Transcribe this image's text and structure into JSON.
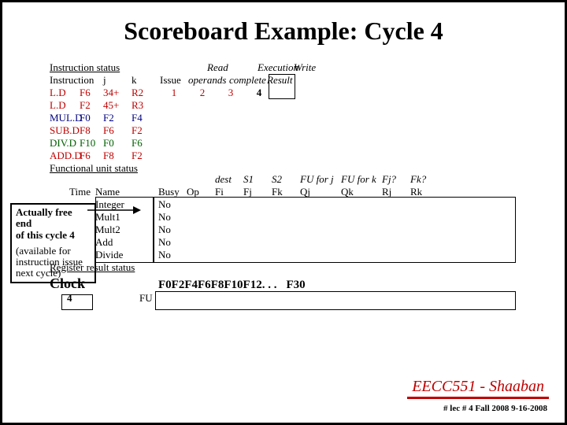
{
  "title": "Scoreboard Example:  Cycle 4",
  "is": {
    "hdr": "Instruction status",
    "cols": {
      "instr": "Instruction",
      "j": "j",
      "k": "k",
      "issue": "Issue",
      "read": "Read\noperands",
      "exec": "Execution\ncomplete",
      "write": "Write\nResult"
    },
    "rows": [
      {
        "c1": "L.D",
        "c2": "F6",
        "j": "34+",
        "k": "R2",
        "issue": "1",
        "read": "2",
        "exec": "3",
        "write": "4",
        "cls": "red"
      },
      {
        "c1": "L.D",
        "c2": "F2",
        "j": "45+",
        "k": "R3",
        "issue": "",
        "read": "",
        "exec": "",
        "write": "",
        "cls": "red"
      },
      {
        "c1": "MUL.D",
        "c2": "F0",
        "j": "F2",
        "k": "F4",
        "issue": "",
        "read": "",
        "exec": "",
        "write": "",
        "cls": "blue"
      },
      {
        "c1": "SUB.D",
        "c2": "F8",
        "j": "F6",
        "k": "F2",
        "issue": "",
        "read": "",
        "exec": "",
        "write": "",
        "cls": "red"
      },
      {
        "c1": "DIV.D",
        "c2": "F10",
        "j": "F0",
        "k": "F6",
        "issue": "",
        "read": "",
        "exec": "",
        "write": "",
        "cls": "green"
      },
      {
        "c1": "ADD.D",
        "c2": "F6",
        "j": "F8",
        "k": "F2",
        "issue": "",
        "read": "",
        "exec": "",
        "write": "",
        "cls": "red"
      }
    ]
  },
  "fu": {
    "hdr": "Functional unit status",
    "cols": {
      "time": "Time",
      "name": "Name",
      "busy": "Busy",
      "op": "Op",
      "fi": "Fi",
      "fj": "Fj",
      "fk": "Fk",
      "qj": "Qj",
      "qk": "Qk",
      "rj": "Rj",
      "rk": "Rk",
      "dest": "dest",
      "s1": "S1",
      "s2": "S2",
      "fuj": "FU for j",
      "fuk": "FU for k",
      "fjq": "Fj?",
      "fkq": "Fk?"
    },
    "rows": [
      {
        "name": "Integer",
        "busy": "No"
      },
      {
        "name": "Mult1",
        "busy": "No"
      },
      {
        "name": "Mult2",
        "busy": "No"
      },
      {
        "name": "Add",
        "busy": "No"
      },
      {
        "name": "Divide",
        "busy": "No"
      }
    ],
    "rrs": "Register result status"
  },
  "clock": {
    "label": "Clock",
    "value": "4",
    "fu": "FU"
  },
  "regs": [
    "F0",
    "F2",
    "F4",
    "F6",
    "F8",
    "F10",
    "F12",
    ". . .",
    "F30"
  ],
  "note": {
    "l1": "Actually free end",
    "l2": "of this cycle 4",
    "l3": "",
    "l4": "(available for",
    "l5": "instruction issue",
    "l6": "next cycle)"
  },
  "footer": {
    "course": "EECC551 - Shaaban",
    "lec": "#  lec # 4  Fall 2008   9-16-2008"
  }
}
